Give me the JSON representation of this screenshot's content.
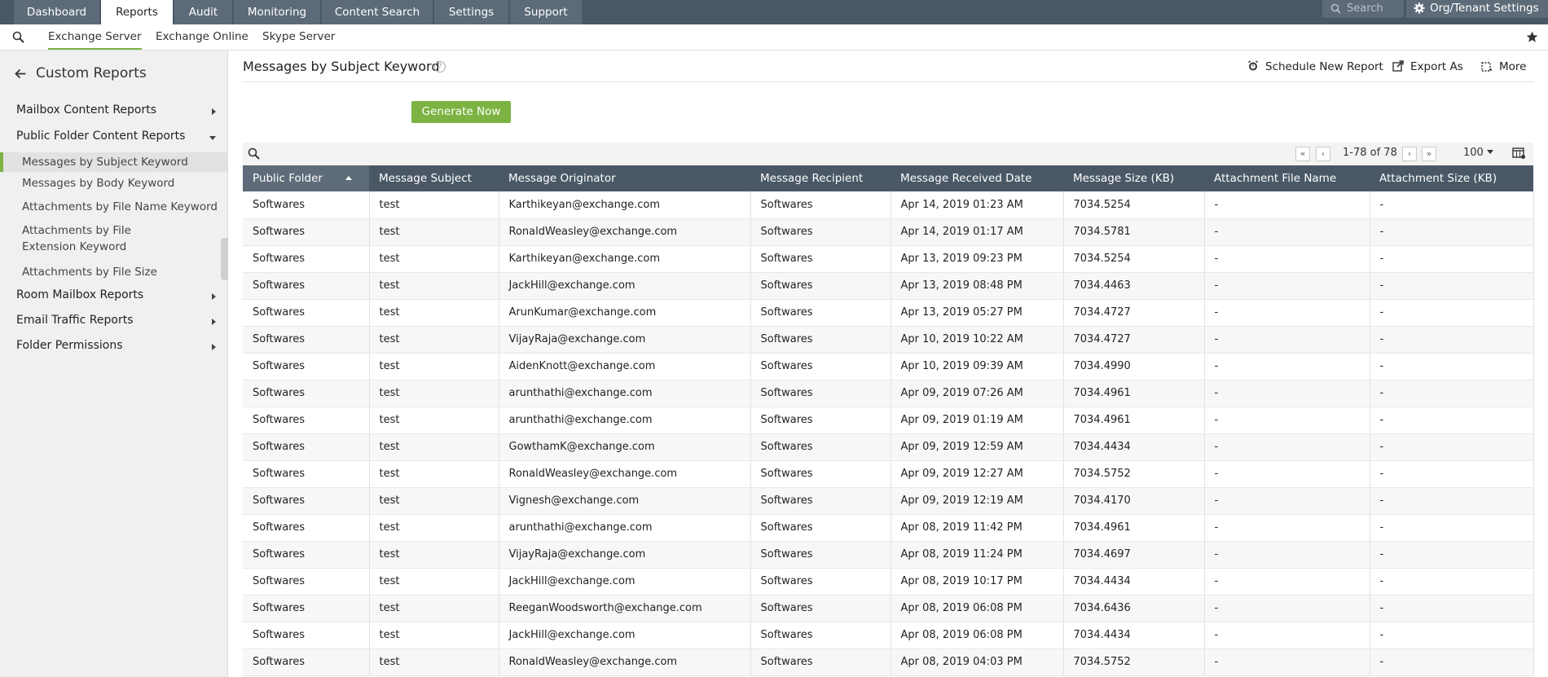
{
  "topnav": {
    "tabs": [
      "Dashboard",
      "Reports",
      "Audit",
      "Monitoring",
      "Content Search",
      "Settings",
      "Support"
    ],
    "search_placeholder": "Search",
    "org_settings": "Org/Tenant Settings"
  },
  "subnav": {
    "tabs": [
      "Exchange Server",
      "Exchange Online",
      "Skype Server"
    ]
  },
  "sidebar": {
    "back_label": "Custom Reports",
    "groups": {
      "mailbox": "Mailbox Content Reports",
      "public_folder": "Public Folder Content Reports",
      "room": "Room Mailbox Reports",
      "email": "Email Traffic Reports",
      "folder": "Folder Permissions"
    },
    "items": [
      "Messages by Subject Keyword",
      "Messages by Body Keyword",
      "Attachments by File Name Keyword",
      "Attachments by File Extension Keyword",
      "Attachments by File Size"
    ]
  },
  "main": {
    "title": "Messages by Subject Keyword",
    "help": "?",
    "schedule": "Schedule New Report",
    "export": "Export As",
    "more": "More",
    "generate": "Generate Now",
    "count": "1-78 of 78",
    "per_page": "100"
  },
  "table": {
    "headers": [
      "Public Folder",
      "Message Subject",
      "Message Originator",
      "Message Recipient",
      "Message Received Date",
      "Message Size (KB)",
      "Attachment File Name",
      "Attachment Size (KB)"
    ],
    "rows": [
      [
        "Softwares",
        "test",
        "Karthikeyan@exchange.com",
        "Softwares",
        "Apr 14, 2019 01:23 AM",
        "7034.5254",
        "-",
        "-"
      ],
      [
        "Softwares",
        "test",
        "RonaldWeasley@exchange.com",
        "Softwares",
        "Apr 14, 2019 01:17 AM",
        "7034.5781",
        "-",
        "-"
      ],
      [
        "Softwares",
        "test",
        "Karthikeyan@exchange.com",
        "Softwares",
        "Apr 13, 2019 09:23 PM",
        "7034.5254",
        "-",
        "-"
      ],
      [
        "Softwares",
        "test",
        "JackHill@exchange.com",
        "Softwares",
        "Apr 13, 2019 08:48 PM",
        "7034.4463",
        "-",
        "-"
      ],
      [
        "Softwares",
        "test",
        "ArunKumar@exchange.com",
        "Softwares",
        "Apr 13, 2019 05:27 PM",
        "7034.4727",
        "-",
        "-"
      ],
      [
        "Softwares",
        "test",
        "VijayRaja@exchange.com",
        "Softwares",
        "Apr 10, 2019 10:22 AM",
        "7034.4727",
        "-",
        "-"
      ],
      [
        "Softwares",
        "test",
        "AidenKnott@exchange.com",
        "Softwares",
        "Apr 10, 2019 09:39 AM",
        "7034.4990",
        "-",
        "-"
      ],
      [
        "Softwares",
        "test",
        "arunthathi@exchange.com",
        "Softwares",
        "Apr 09, 2019 07:26 AM",
        "7034.4961",
        "-",
        "-"
      ],
      [
        "Softwares",
        "test",
        "arunthathi@exchange.com",
        "Softwares",
        "Apr 09, 2019 01:19 AM",
        "7034.4961",
        "-",
        "-"
      ],
      [
        "Softwares",
        "test",
        "GowthamK@exchange.com",
        "Softwares",
        "Apr 09, 2019 12:59 AM",
        "7034.4434",
        "-",
        "-"
      ],
      [
        "Softwares",
        "test",
        "RonaldWeasley@exchange.com",
        "Softwares",
        "Apr 09, 2019 12:27 AM",
        "7034.5752",
        "-",
        "-"
      ],
      [
        "Softwares",
        "test",
        "Vignesh@exchange.com",
        "Softwares",
        "Apr 09, 2019 12:19 AM",
        "7034.4170",
        "-",
        "-"
      ],
      [
        "Softwares",
        "test",
        "arunthathi@exchange.com",
        "Softwares",
        "Apr 08, 2019 11:42 PM",
        "7034.4961",
        "-",
        "-"
      ],
      [
        "Softwares",
        "test",
        "VijayRaja@exchange.com",
        "Softwares",
        "Apr 08, 2019 11:24 PM",
        "7034.4697",
        "-",
        "-"
      ],
      [
        "Softwares",
        "test",
        "JackHill@exchange.com",
        "Softwares",
        "Apr 08, 2019 10:17 PM",
        "7034.4434",
        "-",
        "-"
      ],
      [
        "Softwares",
        "test",
        "ReeganWoodsworth@exchange.com",
        "Softwares",
        "Apr 08, 2019 06:08 PM",
        "7034.6436",
        "-",
        "-"
      ],
      [
        "Softwares",
        "test",
        "JackHill@exchange.com",
        "Softwares",
        "Apr 08, 2019 06:08 PM",
        "7034.4434",
        "-",
        "-"
      ],
      [
        "Softwares",
        "test",
        "RonaldWeasley@exchange.com",
        "Softwares",
        "Apr 08, 2019 04:03 PM",
        "7034.5752",
        "-",
        "-"
      ]
    ]
  },
  "colors": {
    "accent": "#7cb342",
    "nav": "#4a5866"
  }
}
